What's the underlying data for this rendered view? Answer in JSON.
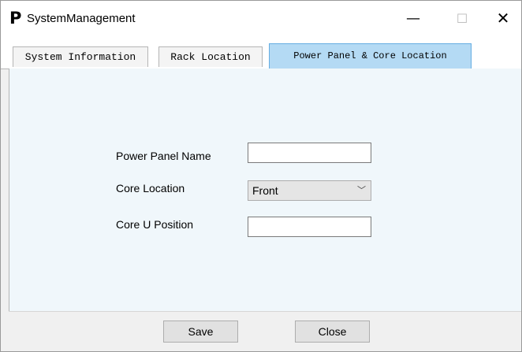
{
  "window": {
    "app_icon_glyph": "P",
    "title": "SystemManagement",
    "minimize_glyph": "—",
    "maximize_glyph": "☐",
    "close_glyph": "✕"
  },
  "tabs": [
    {
      "label": "System Information",
      "active": false
    },
    {
      "label": "Rack Location",
      "active": false
    },
    {
      "label": "Power Panel & Core Location",
      "active": true
    }
  ],
  "form": {
    "power_panel_name": {
      "label": "Power Panel Name",
      "value": ""
    },
    "core_location": {
      "label": "Core Location",
      "value": "Front",
      "chevron": "﹀"
    },
    "core_u_position": {
      "label": "Core U Position",
      "value": ""
    }
  },
  "footer": {
    "save_label": "Save",
    "close_label": "Close"
  },
  "colors": {
    "active_tab": "#b4daf4",
    "active_tab_border": "#66aee2",
    "panel_background": "#f0f7fb"
  }
}
